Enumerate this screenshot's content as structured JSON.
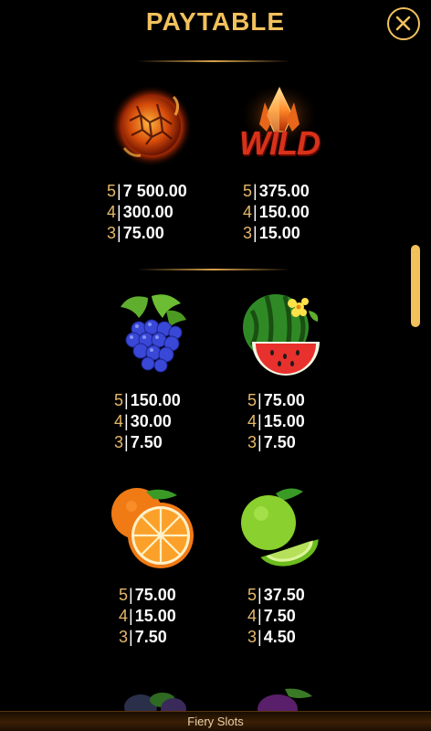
{
  "header": {
    "title": "PAYTABLE"
  },
  "symbols": [
    {
      "icon": "fireball-icon",
      "pays": [
        {
          "count": "5",
          "value": "7 500.00"
        },
        {
          "count": "4",
          "value": "300.00"
        },
        {
          "count": "3",
          "value": "75.00"
        }
      ]
    },
    {
      "icon": "wild-icon",
      "wild_label": "WILD",
      "pays": [
        {
          "count": "5",
          "value": "375.00"
        },
        {
          "count": "4",
          "value": "150.00"
        },
        {
          "count": "3",
          "value": "15.00"
        }
      ]
    },
    {
      "icon": "grapes-icon",
      "pays": [
        {
          "count": "5",
          "value": "150.00"
        },
        {
          "count": "4",
          "value": "30.00"
        },
        {
          "count": "3",
          "value": "7.50"
        }
      ]
    },
    {
      "icon": "watermelon-icon",
      "pays": [
        {
          "count": "5",
          "value": "75.00"
        },
        {
          "count": "4",
          "value": "15.00"
        },
        {
          "count": "3",
          "value": "7.50"
        }
      ]
    },
    {
      "icon": "orange-icon",
      "pays": [
        {
          "count": "5",
          "value": "75.00"
        },
        {
          "count": "4",
          "value": "15.00"
        },
        {
          "count": "3",
          "value": "7.50"
        }
      ]
    },
    {
      "icon": "lime-icon",
      "pays": [
        {
          "count": "5",
          "value": "37.50"
        },
        {
          "count": "4",
          "value": "7.50"
        },
        {
          "count": "3",
          "value": "4.50"
        }
      ]
    }
  ],
  "footer": {
    "game_name": "Fiery Slots"
  },
  "colors": {
    "accent": "#f1c15c",
    "count": "#e6b86a",
    "background": "#000000"
  }
}
